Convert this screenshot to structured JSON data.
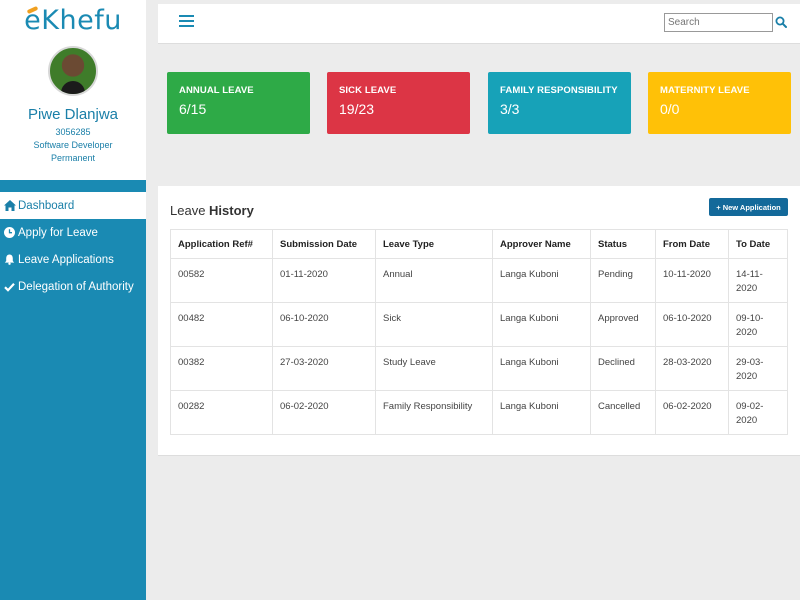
{
  "brand": {
    "logo_text": "eKhefu",
    "accent": "#1a8ab3"
  },
  "profile": {
    "name": "Piwe Dlanjwa",
    "employee_no": "3056285",
    "role": "Software Developer",
    "employment_type": "Permanent"
  },
  "nav": {
    "items": [
      {
        "label": "Dashboard",
        "icon": "home-icon",
        "active": true
      },
      {
        "label": "Apply for Leave",
        "icon": "clock-icon",
        "active": false
      },
      {
        "label": "Leave Applications",
        "icon": "bell-icon",
        "active": false
      },
      {
        "label": "Delegation of Authority",
        "icon": "check-icon",
        "active": false
      }
    ]
  },
  "topbar": {
    "menu_icon": "hamburger-icon",
    "search_placeholder": "Search",
    "search_icon": "search-icon"
  },
  "cards": [
    {
      "title": "ANNUAL LEAVE",
      "value": "6/15",
      "color": "#2eaa47"
    },
    {
      "title": "SICK LEAVE",
      "value": "19/23",
      "color": "#dc3545"
    },
    {
      "title": "FAMILY RESPONSIBILITY",
      "value": "3/3",
      "color": "#17a2b8"
    },
    {
      "title": "MATERNITY LEAVE",
      "value": "0/0",
      "color": "#ffc107"
    }
  ],
  "history": {
    "title_prefix": "Leave ",
    "title_bold": "History",
    "new_button": "+ New Application",
    "columns": [
      "Application Ref#",
      "Submission Date",
      "Leave Type",
      "Approver Name",
      "Status",
      "From Date",
      "To Date"
    ],
    "rows": [
      [
        "00582",
        "01-11-2020",
        "Annual",
        "Langa Kuboni",
        "Pending",
        "10-11-2020",
        "14-11-2020"
      ],
      [
        "00482",
        "06-10-2020",
        "Sick",
        "Langa Kuboni",
        "Approved",
        "06-10-2020",
        "09-10-2020"
      ],
      [
        "00382",
        "27-03-2020",
        "Study Leave",
        "Langa Kuboni",
        "Declined",
        "28-03-2020",
        "29-03-2020"
      ],
      [
        "00282",
        "06-02-2020",
        "Family Responsibility",
        "Langa Kuboni",
        "Cancelled",
        "06-02-2020",
        "09-02-2020"
      ]
    ]
  }
}
